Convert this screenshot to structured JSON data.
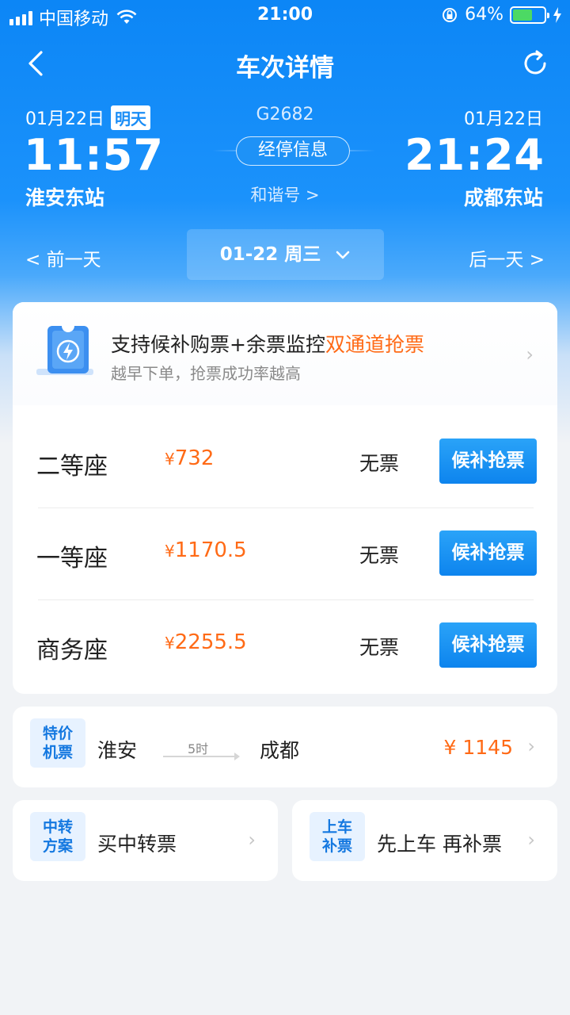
{
  "status_bar": {
    "carrier": "中国移动",
    "time": "21:00",
    "battery_percent": "64%",
    "battery_level": 0.64
  },
  "nav": {
    "title": "车次详情"
  },
  "trip": {
    "departure_date": "01月22日",
    "departure_tag": "明天",
    "train_number": "G2682",
    "arrival_date": "01月22日",
    "departure_time": "11:57",
    "arrival_time": "21:24",
    "stops_button": "经停信息",
    "train_type": "和谐号 >",
    "departure_station": "淮安东站",
    "arrival_station": "成都东站"
  },
  "day_switcher": {
    "prev": "< 前一天",
    "current": "01-22 周三",
    "next": "后一天 >"
  },
  "promo": {
    "title_main": "支持候补购票+余票监控",
    "title_highlight": "双通道抢票",
    "subtitle": "越早下单，抢票成功率越高"
  },
  "seats": [
    {
      "name": "二等座",
      "yen": "¥",
      "price": "732",
      "status": "无票",
      "button": "候补抢票"
    },
    {
      "name": "一等座",
      "yen": "¥",
      "price": "1170.5",
      "status": "无票",
      "button": "候补抢票"
    },
    {
      "name": "商务座",
      "yen": "¥",
      "price": "2255.5",
      "status": "无票",
      "button": "候补抢票"
    }
  ],
  "flight": {
    "badge_line1": "特价",
    "badge_line2": "机票",
    "from": "淮安",
    "duration": "5时",
    "to": "成都",
    "price": "¥ 1145"
  },
  "transfer": {
    "badge_line1": "中转",
    "badge_line2": "方案",
    "label": "买中转票"
  },
  "board_first": {
    "badge_line1": "上车",
    "badge_line2": "补票",
    "label": "先上车 再补票"
  },
  "colors": {
    "brand_blue": "#0c86f6",
    "price_orange": "#ff6a16",
    "button_blue": "#0d84ee"
  }
}
